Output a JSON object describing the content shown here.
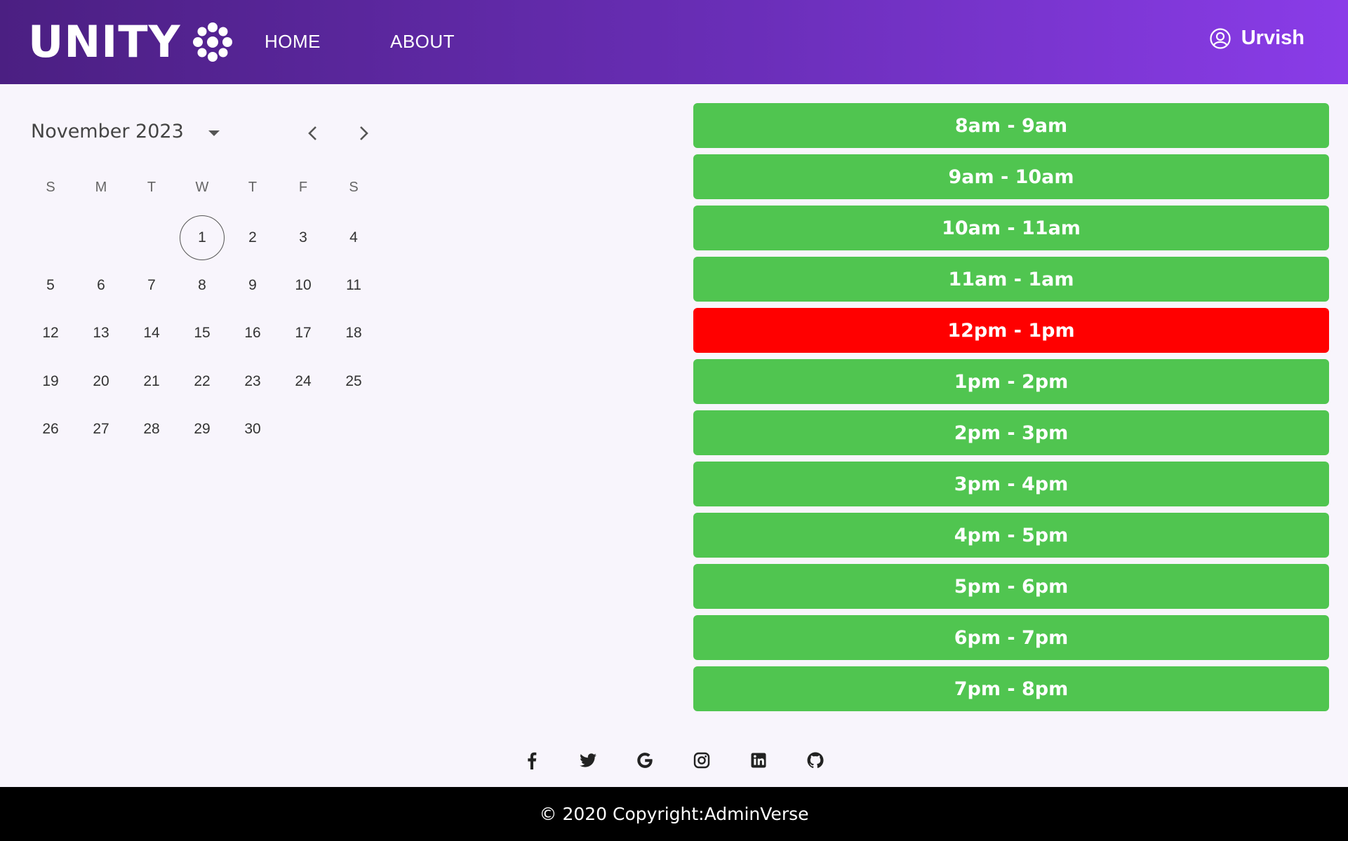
{
  "header": {
    "logo_text": "UNITY",
    "nav": [
      {
        "label": "HOME"
      },
      {
        "label": "ABOUT"
      }
    ],
    "user_name": "Urvish"
  },
  "calendar": {
    "month_label": "November 2023",
    "weekdays": [
      "S",
      "M",
      "T",
      "W",
      "T",
      "F",
      "S"
    ],
    "weeks": [
      [
        "",
        "",
        "",
        "1",
        "2",
        "3",
        "4"
      ],
      [
        "5",
        "6",
        "7",
        "8",
        "9",
        "10",
        "11"
      ],
      [
        "12",
        "13",
        "14",
        "15",
        "16",
        "17",
        "18"
      ],
      [
        "19",
        "20",
        "21",
        "22",
        "23",
        "24",
        "25"
      ],
      [
        "26",
        "27",
        "28",
        "29",
        "30",
        "",
        ""
      ]
    ],
    "today": "1"
  },
  "slots": [
    {
      "label": "8am - 9am",
      "status": "available"
    },
    {
      "label": "9am - 10am",
      "status": "available"
    },
    {
      "label": "10am - 11am",
      "status": "available"
    },
    {
      "label": "11am - 1am",
      "status": "available"
    },
    {
      "label": "12pm - 1pm",
      "status": "booked"
    },
    {
      "label": "1pm - 2pm",
      "status": "available"
    },
    {
      "label": "2pm - 3pm",
      "status": "available"
    },
    {
      "label": "3pm - 4pm",
      "status": "available"
    },
    {
      "label": "4pm - 5pm",
      "status": "available"
    },
    {
      "label": "5pm - 6pm",
      "status": "available"
    },
    {
      "label": "6pm - 7pm",
      "status": "available"
    },
    {
      "label": "7pm - 8pm",
      "status": "available"
    }
  ],
  "colors": {
    "available": "#50c550",
    "booked": "#ff0000",
    "header_start": "#4b1f82",
    "header_end": "#8a3ce8"
  },
  "social_icons": [
    "facebook-icon",
    "twitter-icon",
    "google-icon",
    "instagram-icon",
    "linkedin-icon",
    "github-icon"
  ],
  "footer": {
    "copyright": "© 2020 Copyright:AdminVerse"
  }
}
